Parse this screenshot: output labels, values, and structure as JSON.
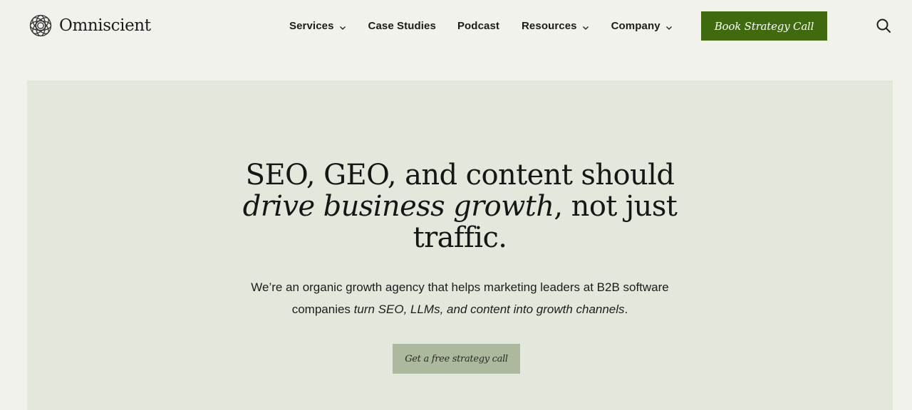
{
  "brand": {
    "name": "Omniscient",
    "logo_icon": "geometric-knot-logo"
  },
  "nav": {
    "items": [
      {
        "label": "Services",
        "has_dropdown": true
      },
      {
        "label": "Case Studies",
        "has_dropdown": false
      },
      {
        "label": "Podcast",
        "has_dropdown": false
      },
      {
        "label": "Resources",
        "has_dropdown": true
      },
      {
        "label": "Company",
        "has_dropdown": true
      }
    ],
    "cta_label": "Book Strategy Call",
    "search_icon": "search-icon"
  },
  "hero": {
    "headline": {
      "line1": "SEO, GEO, and content should",
      "line2_italic": "drive business growth",
      "line2_rest": ", not just",
      "line3": "traffic."
    },
    "subtext": {
      "line1": "We’re an organic growth agency that helps marketing leaders at B2B software",
      "line2_start": "companies ",
      "line2_italic": "turn SEO, LLMs, and content into growth channels",
      "line2_end": "."
    },
    "cta_label": "Get a free strategy call"
  },
  "colors": {
    "page_background": "#f0f2eb",
    "hero_background": "#e3e8dd",
    "primary_button": "#3f6a0e",
    "secondary_button": "#adb99c",
    "text": "#1c1c1c"
  }
}
